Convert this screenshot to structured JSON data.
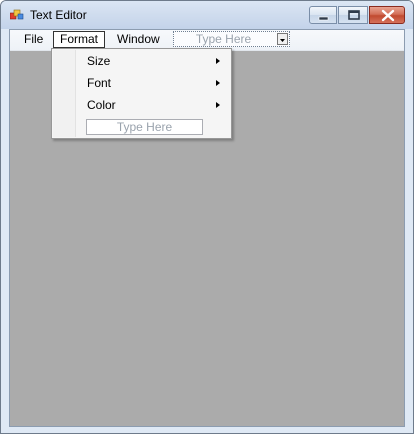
{
  "window": {
    "title": "Text Editor"
  },
  "menubar": {
    "file_label": "File",
    "format_label": "Format",
    "window_label": "Window",
    "combo_placeholder": "Type Here"
  },
  "format_menu": {
    "items": [
      {
        "label": "Size",
        "submenu": true
      },
      {
        "label": "Font",
        "submenu": true
      },
      {
        "label": "Color",
        "submenu": true
      }
    ],
    "textbox_placeholder": "Type Here"
  },
  "icons": {
    "app": "app-icon",
    "minimize": "minimize-icon",
    "maximize": "maximize-icon",
    "close": "close-icon",
    "submenu_arrow": "submenu-arrow-icon",
    "dropdown_arrow": "dropdown-arrow-icon"
  },
  "colors": {
    "workspace": "#ababab",
    "close_button": "#c14a30",
    "placeholder_text": "#9aa3ad"
  }
}
